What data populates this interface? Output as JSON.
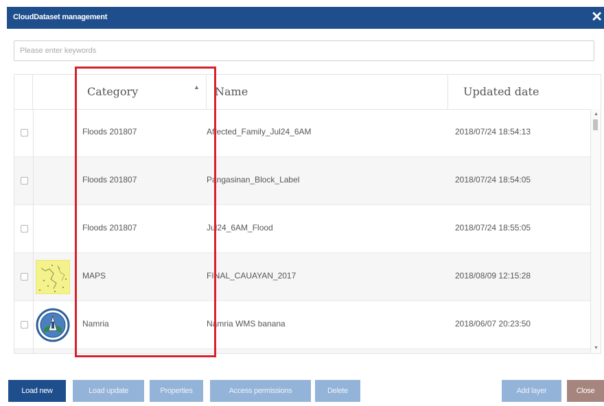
{
  "dialog": {
    "title": "CloudDataset management",
    "close_glyph": "✕"
  },
  "search": {
    "placeholder": "Please enter keywords",
    "value": ""
  },
  "table": {
    "columns": [
      "Category",
      "Name",
      "Updated date"
    ],
    "sort_glyph": "▲",
    "rows": [
      {
        "category": "Floods 201807",
        "name": "Affected_Family_Jul24_6AM",
        "updated": "2018/07/24 18:54:13",
        "thumbnail": ""
      },
      {
        "category": "Floods 201807",
        "name": "Pangasinan_Block_Label",
        "updated": "2018/07/24 18:54:05",
        "thumbnail": ""
      },
      {
        "category": "Floods 201807",
        "name": "Jul24_6AM_Flood",
        "updated": "2018/07/24 18:55:05",
        "thumbnail": ""
      },
      {
        "category": "MAPS",
        "name": "FINAL_CAUAYAN_2017",
        "updated": "2018/08/09 12:15:28",
        "thumbnail": "map-thumbnail"
      },
      {
        "category": "Namria",
        "name": "Namria WMS banana",
        "updated": "2018/06/07 20:23:50",
        "thumbnail": "seal-thumbnail"
      }
    ]
  },
  "scroll": {
    "up": "▲",
    "down": "▼"
  },
  "buttons": {
    "load_new": "Load new",
    "load_update": "Load update",
    "properties": "Properties",
    "access_permissions": "Access permissions",
    "delete": "Delete",
    "add_layer": "Add layer",
    "close": "Close"
  },
  "colors": {
    "title_bar": "#1f4e8c",
    "primary_button": "#1f4e8c",
    "disabled_button": "#93b3d9",
    "close_button": "#a7857f",
    "highlight": "#d8202a"
  }
}
